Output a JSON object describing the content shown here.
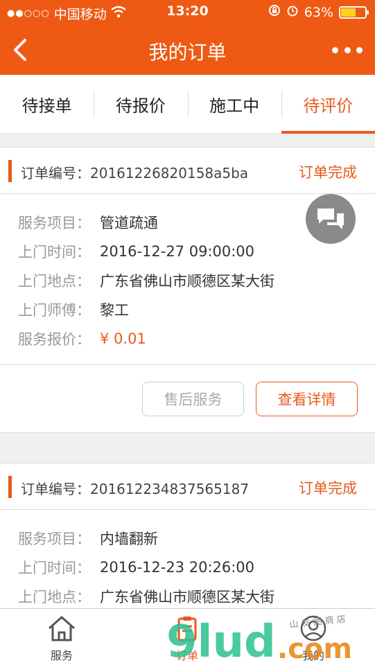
{
  "status_bar": {
    "signal": "●●○○○",
    "carrier": "中国移动",
    "time": "13:20",
    "battery": "63%",
    "battery_level": 0.63,
    "wifi_icon": "wifi-icon",
    "lock_icon": "rotation-lock-icon",
    "alarm_icon": "alarm-icon"
  },
  "nav": {
    "title": "我的订单",
    "back_icon": "chevron-left-icon",
    "more_icon": "more-dots-icon"
  },
  "tabs": [
    {
      "label": "待接单",
      "active": false
    },
    {
      "label": "待报价",
      "active": false
    },
    {
      "label": "施工中",
      "active": false
    },
    {
      "label": "待评价",
      "active": true
    }
  ],
  "orders": [
    {
      "order_label": "订单编号：",
      "order_no": "20161226820158a5ba",
      "status": "订单完成",
      "fields": [
        {
          "k": "服务项目：",
          "v": "管道疏通"
        },
        {
          "k": "上门时间：",
          "v": "2016-12-27 09:00:00"
        },
        {
          "k": "上门地点：",
          "v": "广东省佛山市顺德区某大街"
        },
        {
          "k": "上门师傅：",
          "v": "黎工"
        },
        {
          "k": "服务报价：",
          "v": "¥ 0.01"
        }
      ],
      "btn_after": "售后服务",
      "btn_detail": "查看详情"
    },
    {
      "order_label": "订单编号：",
      "order_no": "201612234837565187",
      "status": "订单完成",
      "fields": [
        {
          "k": "服务项目：",
          "v": "内墙翻新"
        },
        {
          "k": "上门时间：",
          "v": "2016-12-23 20:26:00"
        },
        {
          "k": "上门地点：",
          "v": "广东省佛山市顺德区某大街"
        }
      ]
    }
  ],
  "tabbar": [
    {
      "label": "服务",
      "icon": "home-icon"
    },
    {
      "label": "订单",
      "icon": "order-clipboard-icon"
    },
    {
      "label": "我的",
      "icon": "user-icon"
    }
  ],
  "colors": {
    "brand": "#ee5a14",
    "accent": "#e85a1c"
  }
}
